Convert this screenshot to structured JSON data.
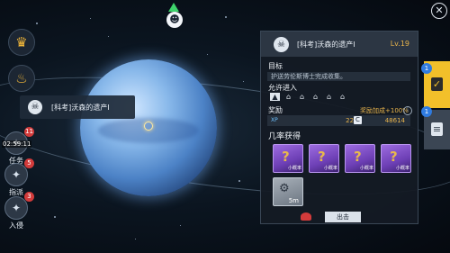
{
  "colors": {
    "accent_gold": "#e8b44c",
    "active_tab": "#f2c02a",
    "badge_red": "#d23b3b",
    "badge_blue": "#2f7be0",
    "player_marker": "#3ed36b"
  },
  "top_marker": {
    "icon": "user-icon"
  },
  "left_buttons": [
    {
      "icon": "crown-icon",
      "glyph": "♛"
    },
    {
      "icon": "flame-icon",
      "glyph": "♨"
    }
  ],
  "planet_label": {
    "text": "[科考]沃森的遗产Ⅰ"
  },
  "sidebar": {
    "task": {
      "label": "任务",
      "badge": "11",
      "timer": "02:59:11"
    },
    "dispatch": {
      "label": "指派",
      "badge": "5"
    },
    "invade": {
      "label": "入侵",
      "badge": "3"
    }
  },
  "mission_panel": {
    "title": "[科考]沃森的遗产Ⅰ",
    "level": "Lv.19",
    "objective_label": "目标",
    "objective_text": "护送劳伦斯博士完成收集。",
    "allow_label": "允许进入",
    "allowed_ship_icons": [
      "▲",
      "⌂",
      "⌂",
      "⌂",
      "⌂",
      "⌂"
    ],
    "reward_label": "奖励",
    "reward_bonus": "奖励加成+100%",
    "reward_info": "i",
    "xp_tag": "XP",
    "xp_value": "2200",
    "credit_tag": "C",
    "credit_value": "48614",
    "drops_label": "几率获得",
    "drops": [
      {
        "icon": "mystery-box-icon",
        "mark": "?",
        "caption": "小概率"
      },
      {
        "icon": "mystery-box-icon",
        "mark": "?",
        "caption": "小概率"
      },
      {
        "icon": "mystery-box-icon",
        "mark": "?",
        "caption": "小概率"
      },
      {
        "icon": "mystery-box-icon",
        "mark": "?",
        "caption": "小概率"
      },
      {
        "icon": "ship-part-icon",
        "mark": "⚙",
        "caption": "5m"
      }
    ],
    "depart_label": "出击"
  },
  "right_tabs": [
    {
      "icon": "mission-clipboard-icon",
      "glyph": "✓",
      "badge": "1",
      "active": true
    },
    {
      "icon": "document-icon",
      "glyph": "≡",
      "badge": "1",
      "active": false
    }
  ],
  "close_icon": "✕"
}
